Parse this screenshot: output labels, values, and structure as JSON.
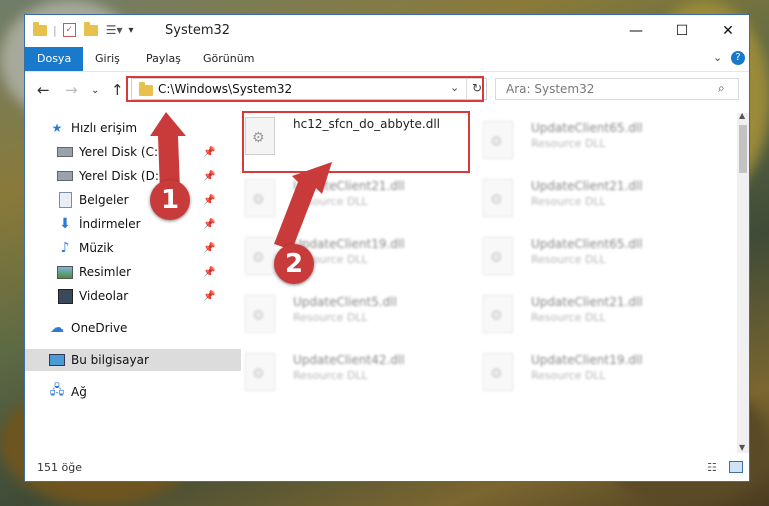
{
  "window": {
    "title": "System32",
    "controls": {
      "minimize": "—",
      "maximize": "☐",
      "close": "✕"
    }
  },
  "ribbon": {
    "tabs": [
      {
        "label": "Dosya",
        "active": true
      },
      {
        "label": "Giriş"
      },
      {
        "label": "Paylaş"
      },
      {
        "label": "Görünüm"
      }
    ],
    "expand_icon": "chevron-down-icon",
    "help_icon": "help-icon",
    "help_label": "?"
  },
  "navigation": {
    "address": "C:\\Windows\\System32",
    "search_placeholder": "Ara: System32"
  },
  "sidebar": {
    "items": [
      {
        "label": "Hızlı erişim",
        "icon": "star-icon",
        "pinned": false
      },
      {
        "label": "Yerel Disk (C:)",
        "icon": "drive-icon",
        "pinned": true
      },
      {
        "label": "Yerel Disk (D:)",
        "icon": "drive-icon",
        "pinned": true
      },
      {
        "label": "Belgeler",
        "icon": "documents-icon",
        "pinned": true
      },
      {
        "label": "İndirmeler",
        "icon": "downloads-icon",
        "pinned": true
      },
      {
        "label": "Müzik",
        "icon": "music-icon",
        "pinned": true
      },
      {
        "label": "Resimler",
        "icon": "pictures-icon",
        "pinned": true
      },
      {
        "label": "Videolar",
        "icon": "videos-icon",
        "pinned": true
      },
      {
        "label": "OneDrive",
        "icon": "cloud-icon",
        "pinned": false
      },
      {
        "label": "Bu bilgisayar",
        "icon": "computer-icon",
        "pinned": false,
        "selected": true
      },
      {
        "label": "Ağ",
        "icon": "network-icon",
        "pinned": false
      }
    ]
  },
  "files": {
    "highlighted": {
      "name": "hc12_sfcn_do_abbyte.dll"
    },
    "left_column": [
      {
        "name": "UpdateClient21.dll",
        "type": "Resource DLL"
      },
      {
        "name": "UpdateClient19.dll",
        "type": "Resource DLL"
      },
      {
        "name": "UpdateClient5.dll",
        "type": "Resource DLL"
      },
      {
        "name": "UpdateClient42.dll",
        "type": "Resource DLL"
      }
    ],
    "right_column": [
      {
        "name": "UpdateClient65.dll",
        "type": "Resource DLL"
      },
      {
        "name": "UpdateClient21.dll",
        "type": "Resource DLL"
      },
      {
        "name": "UpdateClient65.dll",
        "type": "Resource DLL"
      },
      {
        "name": "UpdateClient21.dll",
        "type": "Resource DLL"
      },
      {
        "name": "UpdateClient19.dll",
        "type": "Resource DLL"
      }
    ]
  },
  "status": {
    "count": "151 öğe"
  },
  "annotations": {
    "step1": "1",
    "step2": "2",
    "color": "#d73a3a"
  }
}
